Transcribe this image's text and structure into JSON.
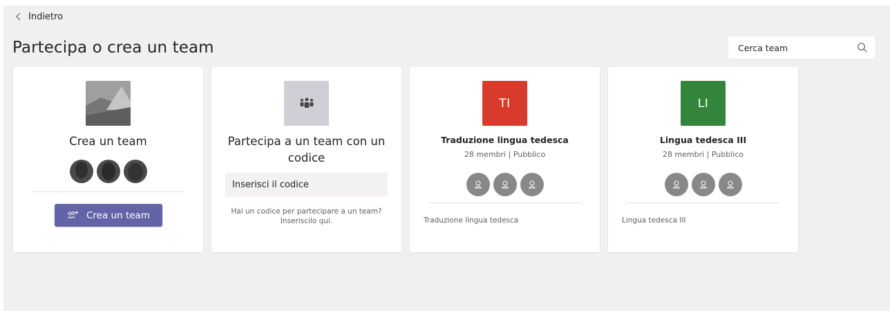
{
  "nav": {
    "back_label": "Indietro"
  },
  "header": {
    "title": "Partecipa o crea un team"
  },
  "search": {
    "placeholder": "Cerca team"
  },
  "create_card": {
    "title": "Crea un team",
    "button_label": "Crea un team"
  },
  "join_card": {
    "title": "Partecipa a un team con un codice",
    "input_placeholder": "Inserisci il codice",
    "hint_line1": "Hai un codice per partecipare a un team?",
    "hint_line2": "Inseriscilo qui."
  },
  "teams": [
    {
      "initials": "TI",
      "name": "Traduzione lingua tedesca",
      "meta": "28 membri | Pubblico",
      "description": "Traduzione lingua tedesca",
      "color": "#d83b2b"
    },
    {
      "initials": "LI",
      "name": "Lingua tedesca III",
      "meta": "28 membri | Pubblico",
      "description": "Lingua tedesca III",
      "color": "#34853c"
    }
  ],
  "colors": {
    "accent": "#6264a7",
    "background": "#f0f0f0",
    "card": "#ffffff",
    "avatar_gray": "#8a8886"
  },
  "icons": [
    "chevron-left-icon",
    "search-icon",
    "team-landscape-icon",
    "team-people-icon",
    "add-people-icon",
    "person-icon"
  ]
}
